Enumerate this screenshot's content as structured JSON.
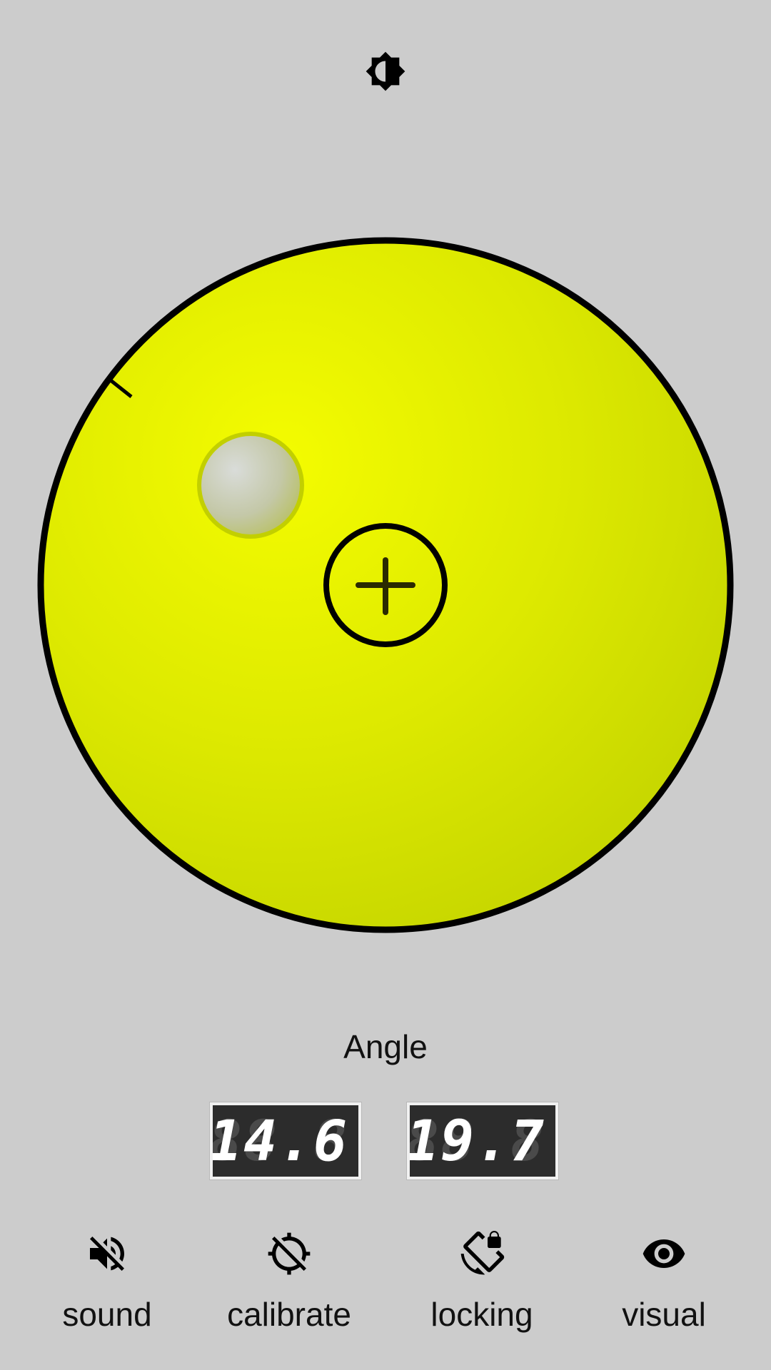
{
  "toolbar_top": {
    "brightness_icon": "brightness-icon"
  },
  "level": {
    "background_color": "#cccccc",
    "vial_color": "#e8f000",
    "bubble_color": "#c8cdaa",
    "bubble_angle_deg": 157
  },
  "angle": {
    "label": "Angle",
    "readings": [
      {
        "value": "14.6",
        "ghost": "88.8"
      },
      {
        "value": "19.7",
        "ghost": "88.8"
      }
    ]
  },
  "toolbar": {
    "items": [
      {
        "label": "sound",
        "icon": "sound-off-icon"
      },
      {
        "label": "calibrate",
        "icon": "calibrate-icon"
      },
      {
        "label": "locking",
        "icon": "screen-lock-rotation-icon"
      },
      {
        "label": "visual",
        "icon": "eye-icon"
      }
    ]
  }
}
